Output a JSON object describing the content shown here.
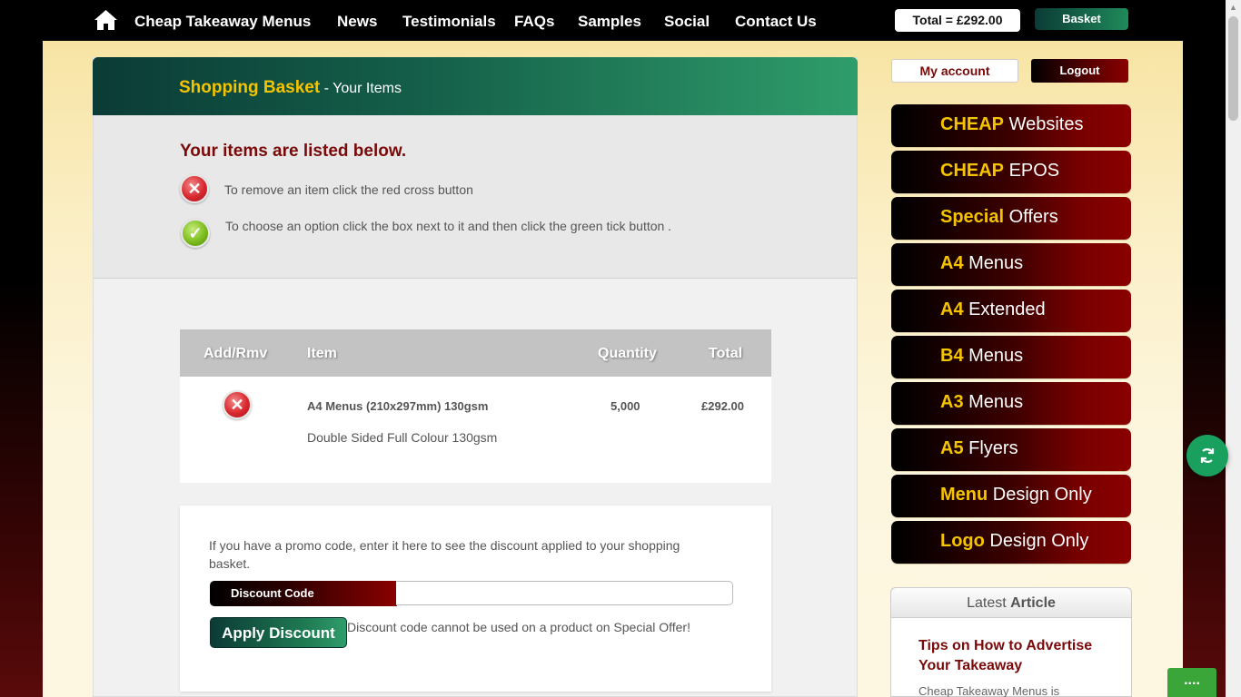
{
  "nav": {
    "brand": "Cheap Takeaway Menus",
    "links": [
      "News",
      "Testimonials",
      "FAQs",
      "Samples",
      "Social",
      "Contact Us"
    ],
    "total": "Total = £292.00",
    "basket": "Basket"
  },
  "panel": {
    "title_highlight": "Shopping Basket",
    "title_rest": " - Your Items",
    "heading": "Your items are listed below.",
    "remove_help": "To remove an item click the red cross button",
    "option_help": "To choose an option click the box next to it and then click the green tick button ."
  },
  "table": {
    "headers": [
      "Add/Rmv",
      "Item",
      "Quantity",
      "Total"
    ],
    "rows": [
      {
        "item": "A4 Menus (210x297mm) 130gsm",
        "description": "Double Sided Full Colour 130gsm",
        "quantity": "5,000",
        "total": "£292.00"
      }
    ]
  },
  "promo": {
    "text": "If you have a promo code, enter it here to see the discount applied to your shopping basket.",
    "label": "Discount Code",
    "input_value": "",
    "apply": "Apply Discount",
    "note": "Discount code cannot be used on a product on Special Offer!"
  },
  "sidebar": {
    "my_account": "My account",
    "logout": "Logout",
    "items": [
      {
        "key": "CHEAP",
        "rest": " Websites"
      },
      {
        "key": "CHEAP",
        "rest": " EPOS"
      },
      {
        "key": "Special",
        "rest": " Offers"
      },
      {
        "key": "A4",
        "rest": " Menus"
      },
      {
        "key": "A4",
        "rest": " Extended"
      },
      {
        "key": "B4",
        "rest": " Menus"
      },
      {
        "key": "A3",
        "rest": " Menus"
      },
      {
        "key": "A5",
        "rest": " Flyers"
      },
      {
        "key": "Menu",
        "rest": " Design Only"
      },
      {
        "key": "Logo",
        "rest": " Design Only"
      }
    ],
    "latest": {
      "head_plain": "Latest ",
      "head_bold": "Article",
      "title": "Tips on How to Advertise Your Takeaway",
      "snippet": "Cheap Takeaway Menus is"
    }
  },
  "widgets": {
    "chat": "...."
  },
  "colors": {
    "accent_yellow": "#f5c400",
    "dark_red": "#7a0a0a",
    "green": "#1f8a5a"
  }
}
